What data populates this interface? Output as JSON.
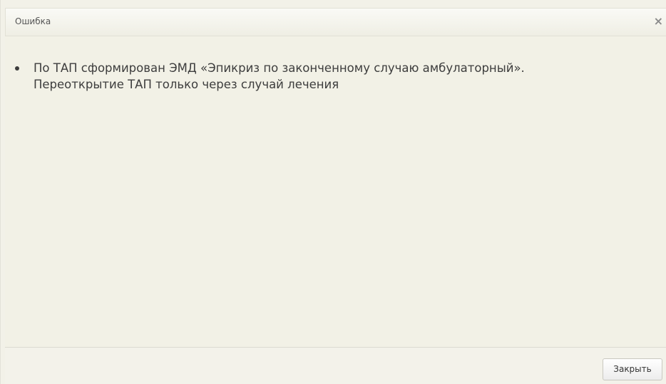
{
  "dialog": {
    "title": "Ошибка",
    "close_icon_glyph": "×",
    "message_lines": [
      "По ТАП сформирован ЭМД «Эпикриз по законченному случаю амбулаторный».",
      "Переоткрытие ТАП только через случай лечения"
    ],
    "close_button_label": "Закрыть"
  }
}
